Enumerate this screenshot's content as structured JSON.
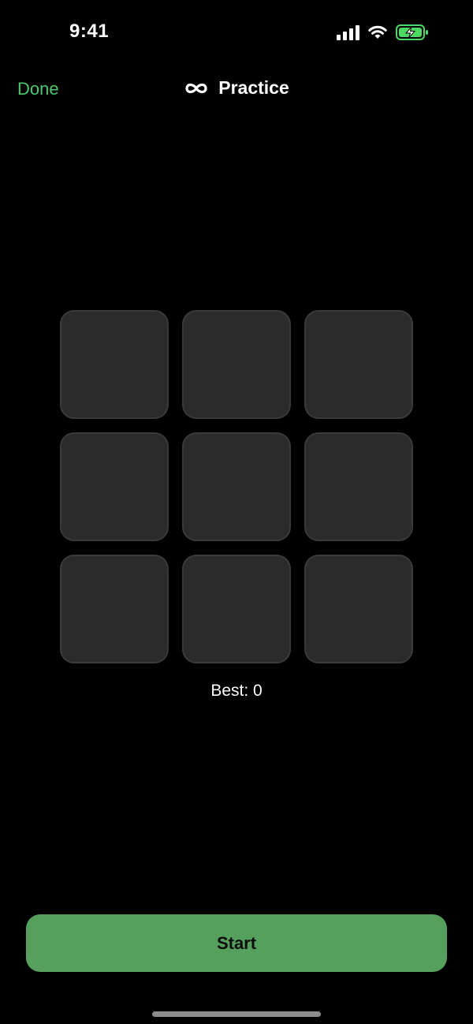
{
  "status_bar": {
    "time": "9:41",
    "icons": [
      "signal-icon",
      "wifi-icon",
      "battery-charging-icon"
    ]
  },
  "nav": {
    "done_label": "Done",
    "title_icon": "infinity-icon",
    "title": "Practice"
  },
  "grid": {
    "rows": 3,
    "columns": 3,
    "tile_count": 9
  },
  "score": {
    "best_text": "Best: 0"
  },
  "actions": {
    "start_label": "Start"
  },
  "colors": {
    "accent_green": "#4cc76b",
    "start_button": "#56a05e",
    "tile": "#2b2b2b",
    "background": "#000000",
    "battery_fill": "#4cd964"
  }
}
